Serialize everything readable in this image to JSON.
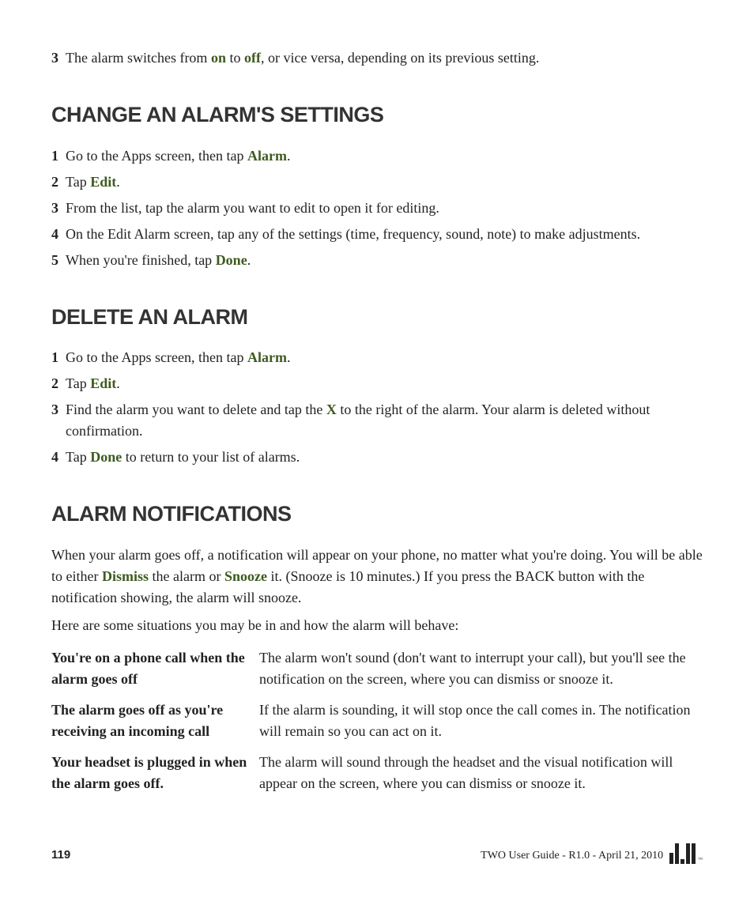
{
  "intro_step": {
    "num": "3",
    "pre": "The alarm switches from ",
    "b1": "on",
    "mid": " to ",
    "b2": "off",
    "post": ", or vice versa, depending on its previous setting."
  },
  "section1": {
    "heading": "CHANGE AN ALARM'S SETTINGS",
    "steps": [
      {
        "num": "1",
        "pre": "Go to the Apps screen, then tap ",
        "b1": "Alarm",
        "post": "."
      },
      {
        "num": "2",
        "pre": "Tap ",
        "b1": "Edit",
        "post": "."
      },
      {
        "num": "3",
        "pre": "From the list, tap the alarm you want to edit to open it for editing."
      },
      {
        "num": "4",
        "pre": "On the Edit Alarm screen, tap any of the settings (time, frequency, sound, note) to make adjustments."
      },
      {
        "num": "5",
        "pre": "When you're finished, tap ",
        "b1": "Done",
        "post": "."
      }
    ]
  },
  "section2": {
    "heading": "DELETE AN ALARM",
    "steps": [
      {
        "num": "1",
        "pre": "Go to the Apps screen, then tap ",
        "b1": "Alarm",
        "post": "."
      },
      {
        "num": "2",
        "pre": "Tap ",
        "b1": "Edit",
        "post": "."
      },
      {
        "num": "3",
        "pre": "Find the alarm you want to delete and tap the ",
        "b1": "X",
        "post": " to the right of the alarm. Your alarm is deleted without confirmation."
      },
      {
        "num": "4",
        "pre": "Tap ",
        "b1": "Done",
        "post": " to return to your list of alarms."
      }
    ]
  },
  "section3": {
    "heading": "ALARM NOTIFICATIONS",
    "para1": {
      "pre": "When your alarm goes off, a notification will appear on your phone, no matter what you're doing. You will be able to either ",
      "b1": "Dismiss",
      "mid": " the alarm or ",
      "b2": "Snooze",
      "post": " it. (Snooze is 10 minutes.) If you press the BACK button with the notification showing, the alarm will snooze."
    },
    "para2": "Here are some situations you may be in and how the alarm will behave:",
    "rows": [
      {
        "label": "You're on a phone call when the alarm goes off",
        "desc": "The alarm won't sound (don't want to interrupt your call), but you'll see the notification on the screen, where you can dismiss or snooze it."
      },
      {
        "label": "The alarm goes off as you're receiving an incoming call",
        "desc": "If the alarm is sounding, it will stop once the call comes in. The notification will remain so you can act on it."
      },
      {
        "label": "Your headset is plugged in when the alarm goes off.",
        "desc": "The alarm will sound through the headset and the visual notification will appear on the screen, where you can dismiss or snooze it."
      }
    ]
  },
  "footer": {
    "page": "119",
    "guide": "TWO User Guide - R1.0 - April 21, 2010"
  }
}
